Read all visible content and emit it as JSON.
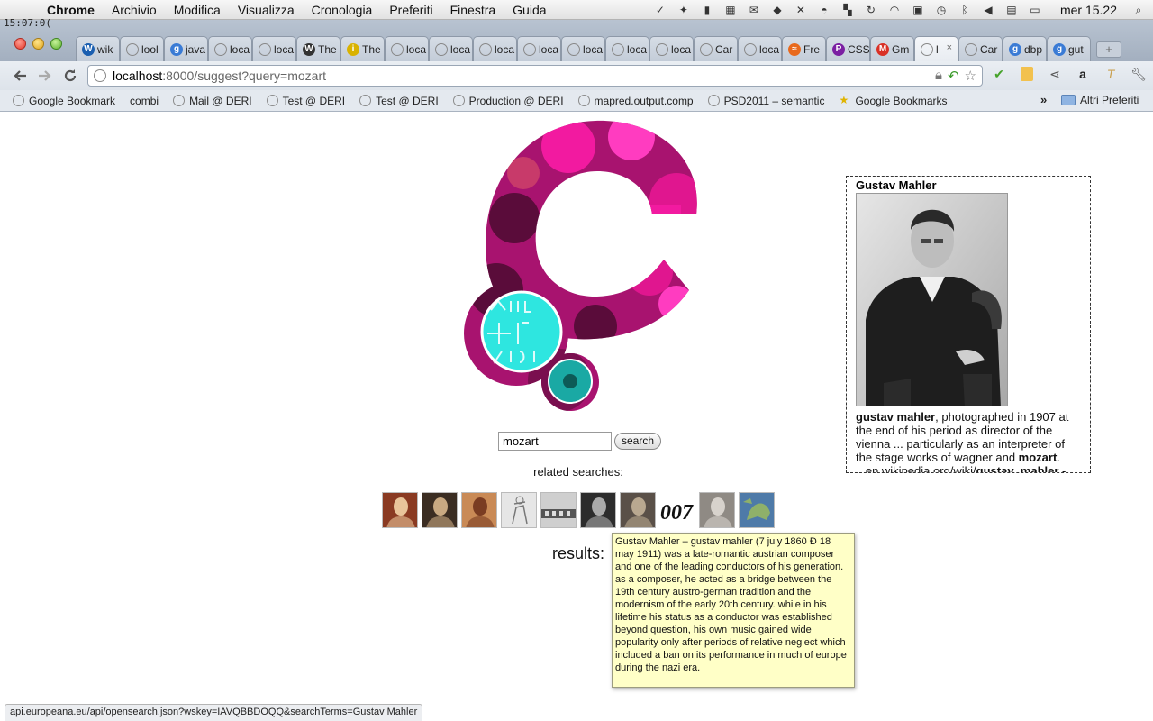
{
  "menubar": {
    "app": "Chrome",
    "items": [
      "Archivio",
      "Modifica",
      "Visualizza",
      "Cronologia",
      "Preferiti",
      "Finestra",
      "Guida"
    ],
    "clock": "mer 15.22",
    "tray_icons": [
      "evernote-icon",
      "twitter-icon",
      "green-app-icon",
      "calendar-icon",
      "mail-icon",
      "dropbox-icon",
      "bluetooth-cross-icon",
      "hat-icon",
      "spaces-icon",
      "sync-icon",
      "wifi-icon",
      "lock-icon",
      "time-machine-icon",
      "bluetooth-icon",
      "volume-icon",
      "flag-pro-icon",
      "battery-icon",
      "spotlight-icon"
    ]
  },
  "overlay_clock": "15:07:0(",
  "tabs": [
    {
      "label": "wik",
      "favicon": "W",
      "favicon_color": "#1b5fb0"
    },
    {
      "label": "lool",
      "favicon": "",
      "favicon_color": "#888"
    },
    {
      "label": "java",
      "favicon": "g",
      "favicon_color": "#3a7bd5"
    },
    {
      "label": "loca",
      "favicon": "",
      "favicon_color": "#888"
    },
    {
      "label": "loca",
      "favicon": "",
      "favicon_color": "#888"
    },
    {
      "label": "The",
      "favicon": "W",
      "favicon_color": "#333"
    },
    {
      "label": "The",
      "favicon": "i",
      "favicon_color": "#d9b200"
    },
    {
      "label": "loca",
      "favicon": "",
      "favicon_color": "#888"
    },
    {
      "label": "loca",
      "favicon": "",
      "favicon_color": "#888"
    },
    {
      "label": "loca",
      "favicon": "",
      "favicon_color": "#888"
    },
    {
      "label": "loca",
      "favicon": "",
      "favicon_color": "#888"
    },
    {
      "label": "loca",
      "favicon": "",
      "favicon_color": "#888"
    },
    {
      "label": "loca",
      "favicon": "",
      "favicon_color": "#888"
    },
    {
      "label": "loca",
      "favicon": "",
      "favicon_color": "#888"
    },
    {
      "label": "Car",
      "favicon": "",
      "favicon_color": "#888"
    },
    {
      "label": "loca",
      "favicon": "",
      "favicon_color": "#888"
    },
    {
      "label": "Fre",
      "favicon": "≈",
      "favicon_color": "#e8691c"
    },
    {
      "label": "CSS",
      "favicon": "P",
      "favicon_color": "#7b1fa2"
    },
    {
      "label": "Gm",
      "favicon": "M",
      "favicon_color": "#d93025"
    },
    {
      "label": "l",
      "favicon": "",
      "favicon_color": "#888",
      "active": true
    },
    {
      "label": "Car",
      "favicon": "",
      "favicon_color": "#888"
    },
    {
      "label": "dbp",
      "favicon": "g",
      "favicon_color": "#3a7bd5"
    },
    {
      "label": "gut",
      "favicon": "g",
      "favicon_color": "#3a7bd5"
    }
  ],
  "address": {
    "host": "localhost",
    "path": ":8000/suggest?query=mozart"
  },
  "bookmarks": [
    {
      "label": "Google Bookmark",
      "icon": "globe"
    },
    {
      "label": "combi",
      "icon": "page"
    },
    {
      "label": "Mail @ DERI",
      "icon": "globe"
    },
    {
      "label": "Test @ DERI",
      "icon": "globe"
    },
    {
      "label": "Test @ DERI",
      "icon": "globe"
    },
    {
      "label": "Production @ DERI",
      "icon": "globe"
    },
    {
      "label": "mapred.output.comp",
      "icon": "globe"
    },
    {
      "label": "PSD2011 – semantic",
      "icon": "globe"
    },
    {
      "label": "Google Bookmarks",
      "icon": "star"
    }
  ],
  "bookmarks_more": "»",
  "other_bookmarks": "Altri Preferiti",
  "search": {
    "value": "mozart",
    "button": "search"
  },
  "related_label": "related searches:",
  "related_thumbs": [
    {
      "name": "thumb-mozart-portrait",
      "bg": "#8a3a22",
      "fg": "#e9c49a"
    },
    {
      "name": "thumb-bach-portrait",
      "bg": "#3b2d22",
      "fg": "#c9a982"
    },
    {
      "name": "thumb-painting-framed",
      "bg": "#c98a56",
      "fg": "#7a3c22"
    },
    {
      "name": "thumb-sketch",
      "bg": "#e6e6e6",
      "fg": "#777"
    },
    {
      "name": "thumb-building-photo",
      "bg": "#cfcfcf",
      "fg": "#555"
    },
    {
      "name": "thumb-bw-man",
      "bg": "#2c2c2c",
      "fg": "#aaa"
    },
    {
      "name": "thumb-round-portrait",
      "bg": "#5a5048",
      "fg": "#b9a890"
    },
    {
      "name": "thumb-007-logo",
      "bg": "#ffffff",
      "fg": "#111"
    },
    {
      "name": "thumb-old-man-photo",
      "bg": "#8f8a84",
      "fg": "#d7d2cc"
    },
    {
      "name": "thumb-europe-map",
      "bg": "#4e7aa8",
      "fg": "#8fb06a"
    }
  ],
  "results_label": "results:",
  "infobox": {
    "title": "Gustav Mahler",
    "text_1_bold": "gustav mahler",
    "text_2": ", photographed in 1907 at the end of his period as director of the vienna ... particularly as an interpreter of the stage works of wagner and ",
    "text_3_bold": "mozart",
    "text_4": ".",
    "link_prefix": "...en.wikipedia.org/wiki/",
    "link_bold": "gustav_mahler",
    "link_suffix": " -"
  },
  "tooltip": "Gustav Mahler – gustav mahler (7 july 1860 Ð 18 may 1911) was a late-romantic austrian composer and one of the leading conductors of his generation. as a composer, he acted as a bridge between the 19th century austro-german tradition and the modernism of the early 20th century. while in his lifetime his status as a conductor was established beyond question, his own music gained wide popularity only after periods of relative neglect which included a ban on its performance in much of europe during the nazi era.",
  "status_url": "api.europeana.eu/api/opensearch.json?wskey=IAVQBBDOQQ&searchTerms=Gustav Mahler",
  "colors": {
    "logo_magenta": "#e0168f",
    "logo_dark": "#5a0c3a",
    "logo_cyan": "#2ee6e0",
    "tooltip_bg": "#ffffc7"
  }
}
